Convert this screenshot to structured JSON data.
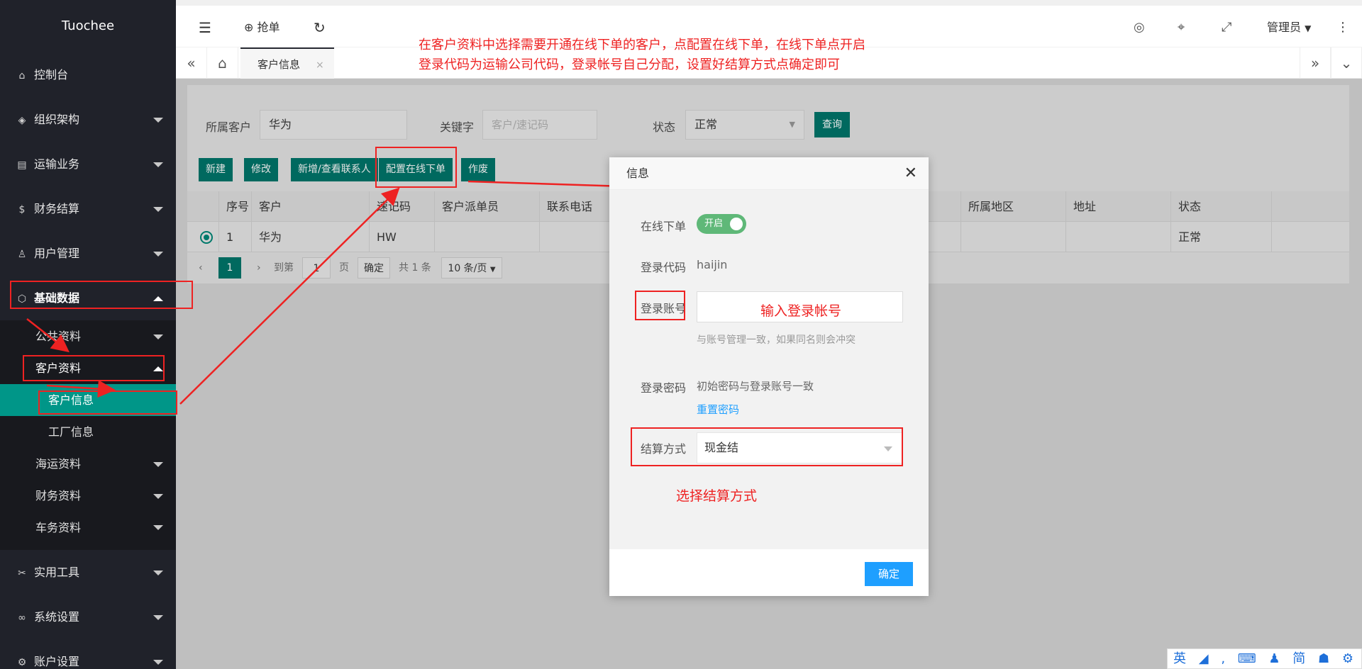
{
  "app": {
    "logo": "Tuochee"
  },
  "sidebar": {
    "items": [
      {
        "label": "控制台"
      },
      {
        "label": "组织架构"
      },
      {
        "label": "运输业务"
      },
      {
        "label": "财务结算"
      },
      {
        "label": "用户管理"
      },
      {
        "label": "基础数据"
      }
    ],
    "basic": {
      "public": "公共资料",
      "customer": "客户资料",
      "customer_info": "客户信息",
      "factory_info": "工厂信息",
      "shipping": "海运资料",
      "finance": "财务资料",
      "vehicle": "车务资料"
    },
    "bottom": [
      {
        "label": "实用工具"
      },
      {
        "label": "系统设置"
      },
      {
        "label": "账户设置"
      }
    ]
  },
  "topbar": {
    "grab_order": "抢单",
    "admin": "管理员"
  },
  "tabs": {
    "current": "客户信息",
    "close": "×"
  },
  "search": {
    "customer_label": "所属客户",
    "customer_value": "华为",
    "keyword_label": "关键字",
    "keyword_placeholder": "客户/速记码",
    "status_label": "状态",
    "status_value": "正常",
    "query": "查询"
  },
  "actions": {
    "new": "新建",
    "edit": "修改",
    "contact": "新增/查看联系人",
    "online": "配置在线下单",
    "void": "作废"
  },
  "table": {
    "headers": [
      "序号",
      "客户",
      "速记码",
      "客户派单员",
      "联系电话",
      "所属地区",
      "地址",
      "状态"
    ],
    "rows": [
      {
        "no": "1",
        "customer": "华为",
        "code": "HW",
        "status": "正常"
      }
    ]
  },
  "pager": {
    "current": "1",
    "goto": "到第",
    "page_value": "1",
    "page": "页",
    "confirm": "确定",
    "total": "共 1 条",
    "size": "10 条/页"
  },
  "modal": {
    "title": "信息",
    "online_label": "在线下单",
    "switch_text": "开启",
    "code_label": "登录代码",
    "code_value": "haijin",
    "account_label": "登录账号",
    "account_hint": "与账号管理一致，如果同名则会冲突",
    "password_label": "登录密码",
    "password_value": "初始密码与登录账号一致",
    "reset": "重置密码",
    "settle_label": "结算方式",
    "settle_value": "现金结",
    "ok": "确定"
  },
  "annotations": {
    "line1": "在客户资料中选择需要开通在线下单的客户，点配置在线下单，在线下单点开启",
    "line2": "登录代码为运输公司代码，登录帐号自己分配，设置好结算方式点确定即可",
    "input_account": "输入登录帐号",
    "choose_settle": "选择结算方式"
  },
  "ime": {
    "text": "英 ◢ ‚ ⌨ ♟ 简 ☗ ⚙"
  },
  "colors": {
    "sidebar": "#20222a",
    "accent": "#009688",
    "annotation": "#ee2222",
    "primary": "#1e9fff"
  }
}
